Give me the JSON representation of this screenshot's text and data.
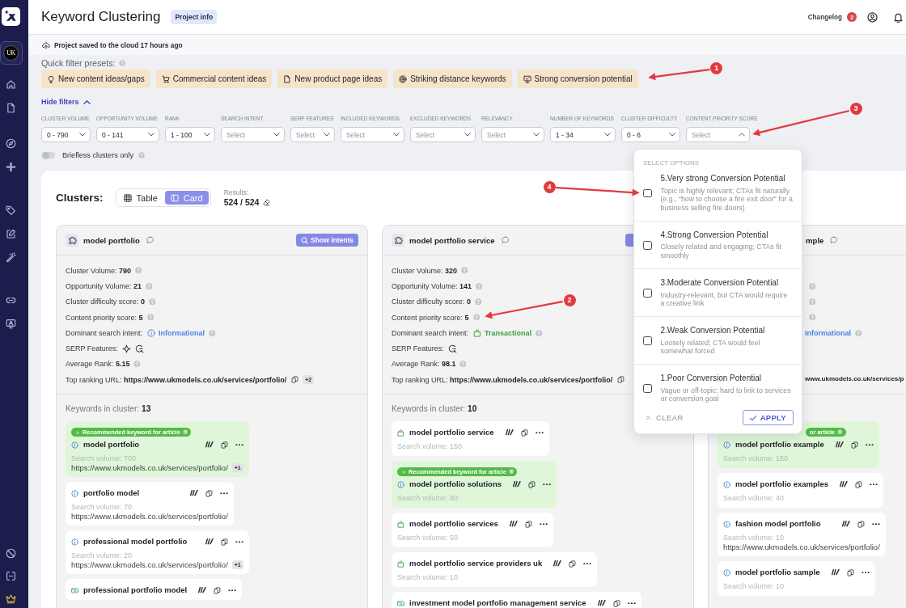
{
  "sidebar": {
    "project": "UK"
  },
  "header": {
    "title": "Keyword Clustering",
    "badge": "Project info",
    "changelog": "Changelog",
    "changelog_count": "2"
  },
  "save_status": "Project saved to the cloud 17 hours ago",
  "quick_filters": {
    "label": "Quick filter presets:",
    "presets": [
      {
        "label": "New content ideas/gaps"
      },
      {
        "label": "Commercial content ideas"
      },
      {
        "label": "New product page ideas"
      },
      {
        "label": "Striking distance keywords"
      },
      {
        "label": "Strong conversion potential",
        "callout": "1"
      }
    ]
  },
  "hide_filters": "Hide filters",
  "filters": [
    {
      "label": "CLUSTER VOLUME",
      "value": "0 - 790",
      "expanded": false
    },
    {
      "label": "OPPORTUNITY VOLUME",
      "value": "0 - 141",
      "expanded": false
    },
    {
      "label": "RANK",
      "value": "1 - 100",
      "expanded": false
    },
    {
      "label": "SEARCH INTENT",
      "placeholder": "Select",
      "expanded": false
    },
    {
      "label": "SERP FEATURES",
      "placeholder": "Select",
      "expanded": false
    },
    {
      "label": "INCLUDED KEYWORDS",
      "placeholder": "Select",
      "expanded": false
    },
    {
      "label": "EXCLUDED KEYWORDS",
      "placeholder": "Select",
      "expanded": false
    },
    {
      "label": "RELEVANCY",
      "placeholder": "Select",
      "expanded": false
    },
    {
      "label": "NUMBER OF KEYWORDS",
      "value": "1 - 34",
      "expanded": false
    },
    {
      "label": "CLUSTER DIFFICULTY",
      "value": "0 - 6",
      "expanded": false
    },
    {
      "label": "CONTENT PRIORITY SCORE",
      "placeholder": "Select",
      "expanded": true,
      "callout": "3",
      "menu": {
        "heading": "SELECT OPTIONS",
        "options": [
          {
            "title": "5.Very strong Conversion Potential",
            "description": "Topic is highly relevant; CTAs fit naturally (e.g., “how to choose a fire exit door” for a business selling fire doors)",
            "checked": false,
            "callout": "4"
          },
          {
            "title": "4.Strong Conversion Potential",
            "description": "Closely related and engaging; CTAs fit smoothly",
            "checked": false
          },
          {
            "title": "3.Moderate Conversion Potential",
            "description": "Industry-relevant, but CTA would require a creative link",
            "checked": false
          },
          {
            "title": "2.Weak Conversion Potential",
            "description": "Loosely related; CTA would feel somewhat forced",
            "checked": false
          },
          {
            "title": "1.Poor Conversion Potential",
            "description": "Vague or off-topic; hard to link to services or conversion goal",
            "checked": false
          }
        ],
        "clear": "CLEAR",
        "apply": "APPLY"
      }
    }
  ],
  "briefless": {
    "label": "Briefless clusters only",
    "on": false
  },
  "clusters_view": {
    "title": "Clusters:",
    "views": [
      {
        "label": "Table",
        "selected": false
      },
      {
        "label": "Card",
        "selected": true
      }
    ],
    "results_label": "Results:",
    "results": "524 / 524"
  },
  "clusters": [
    {
      "title": "model portfolio",
      "intents_button": {
        "label": "Show intents",
        "clipped": false
      },
      "stats": [
        {
          "kind": "number",
          "label": "Cluster Volume:",
          "value": "790"
        },
        {
          "kind": "number",
          "label": "Opportunity Volume:",
          "value": "21"
        },
        {
          "kind": "number",
          "label": "Cluster difficulty score:",
          "value": "0"
        },
        {
          "kind": "number",
          "label": "Content priority score:",
          "value": "5"
        },
        {
          "kind": "intent",
          "label": "Dominant search intent:",
          "intent": {
            "kind": "informational",
            "label": "Informational"
          }
        },
        {
          "kind": "serp",
          "label": "SERP Features:",
          "features": [
            {
              "kind": "sparkle"
            },
            {
              "kind": "search"
            }
          ]
        },
        {
          "kind": "number",
          "label": "Average Rank:",
          "value": "5.15"
        },
        {
          "kind": "url",
          "label": "Top ranking URL:",
          "value": "https://www.ukmodels.co.uk/services/portfolio/",
          "extra": "+2"
        }
      ],
      "keywords_label": "Keywords in cluster:",
      "keywords_count": "13",
      "keywords": [
        {
          "text": "model portfolio",
          "kind": "informational",
          "recommended": true,
          "badge": "Recommended keyword for article",
          "volume": "Search volume: 700",
          "url": "https://www.ukmodels.co.uk/services/portfolio/",
          "extra": "+1"
        },
        {
          "text": "portfolio model",
          "kind": "informational",
          "recommended": false,
          "volume": "Search volume: 70",
          "url": "https://www.ukmodels.co.uk/services/portfolio/"
        },
        {
          "text": "professional model portfolio",
          "kind": "informational",
          "recommended": false,
          "volume": "Search volume: 20",
          "url": "https://www.ukmodels.co.uk/services/portfolio/",
          "extra": "+1"
        },
        {
          "text": "professional portfolio model",
          "kind": "commercial",
          "recommended": false
        }
      ]
    },
    {
      "title": "model portfolio service",
      "intents_button": {
        "clipped": true
      },
      "stats": [
        {
          "kind": "number",
          "label": "Cluster Volume:",
          "value": "320"
        },
        {
          "kind": "number",
          "label": "Opportunity Volume:",
          "value": "141"
        },
        {
          "kind": "number",
          "label": "Cluster difficulty score:",
          "value": "0"
        },
        {
          "kind": "number",
          "label": "Content priority score:",
          "value": "5",
          "callout": "2"
        },
        {
          "kind": "intent",
          "label": "Dominant search intent:",
          "intent": {
            "kind": "transactional",
            "label": "Transactional"
          }
        },
        {
          "kind": "serp",
          "label": "SERP Features:",
          "features": [
            {
              "kind": "search"
            }
          ]
        },
        {
          "kind": "number",
          "label": "Average Rank:",
          "value": "98.1"
        },
        {
          "kind": "url",
          "label": "Top ranking URL:",
          "value": "https://www.ukmodels.co.uk/services/portfolio/"
        }
      ],
      "keywords_label": "Keywords in cluster:",
      "keywords_count": "10",
      "keywords": [
        {
          "text": "model portfolio service",
          "kind": "transactional",
          "recommended": false,
          "volume": "Search volume: 150"
        },
        {
          "text": "model portfolio solutions",
          "kind": "informational",
          "recommended": true,
          "badge": "Recommended keyword for article",
          "volume": "Search volume: 80"
        },
        {
          "text": "model portfolio services",
          "kind": "transactional",
          "recommended": false,
          "volume": "Search volume: 50"
        },
        {
          "text": "model portfolio service providers uk",
          "kind": "transactional",
          "recommended": false,
          "volume": "Search volume: 10"
        },
        {
          "text": "investment model portfolio management service",
          "kind": "commercial",
          "recommended": false
        }
      ]
    },
    {
      "title": "mple",
      "stats": [
        {
          "kind": "number"
        },
        {
          "kind": "number"
        },
        {
          "kind": "number"
        },
        {
          "kind": "intent",
          "intent": {
            "kind": "informational",
            "label": "Informational"
          }
        },
        {
          "kind": "url",
          "value": "www.ukmodels.co.uk/services/p"
        }
      ],
      "keywords": [
        {
          "text": "model portfolio example",
          "kind": "informational",
          "recommended": true,
          "badge": "or article",
          "volume": "Search volume: 150"
        },
        {
          "text": "model portfolio examples",
          "kind": "informational",
          "recommended": false,
          "volume": "Search volume: 40"
        },
        {
          "text": "fashion model portfolio",
          "kind": "informational",
          "recommended": false,
          "volume": "Search volume: 10",
          "url": "https://www.ukmodels.co.uk/services/portfolio/"
        },
        {
          "text": "model portfolio sample",
          "kind": "informational",
          "recommended": false,
          "volume": "Search volume: 10"
        }
      ]
    }
  ]
}
